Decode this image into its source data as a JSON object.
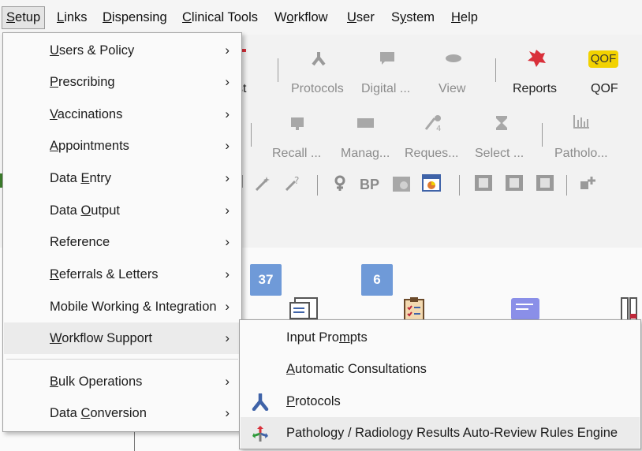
{
  "menubar": {
    "items": [
      {
        "pre": "",
        "acc": "S",
        "post": "etup"
      },
      {
        "pre": "",
        "acc": "L",
        "post": "inks"
      },
      {
        "pre": "",
        "acc": "D",
        "post": "ispensing"
      },
      {
        "pre": "",
        "acc": "C",
        "post": "linical Tools"
      },
      {
        "pre": "W",
        "acc": "o",
        "post": "rkflow"
      },
      {
        "pre": "",
        "acc": "U",
        "post": "ser"
      },
      {
        "pre": "S",
        "acc": "y",
        "post": "stem"
      },
      {
        "pre": "",
        "acc": "H",
        "post": "elp"
      }
    ]
  },
  "toolbar": {
    "row1": {
      "partial_label": "st",
      "protocols": "Protocols",
      "digital": "Digital ...",
      "view": "View",
      "reports": "Reports",
      "qof": "QOF",
      "qof_icon_text": "QOF"
    },
    "row2": {
      "recall": "Recall ...",
      "manage": "Manag...",
      "requests": "Reques...",
      "select": "Select ...",
      "pathology": "Patholo..."
    },
    "row3": {
      "bp_text": "BP"
    }
  },
  "badges": {
    "badge1": "37",
    "badge2": "6"
  },
  "setup_menu": {
    "items": [
      {
        "pre": "",
        "acc": "U",
        "post": "sers & Policy"
      },
      {
        "pre": "",
        "acc": "P",
        "post": "rescribing"
      },
      {
        "pre": "",
        "acc": "V",
        "post": "accinations"
      },
      {
        "pre": "",
        "acc": "A",
        "post": "ppointments"
      },
      {
        "pre": "Data ",
        "acc": "E",
        "post": "ntry"
      },
      {
        "pre": "Data ",
        "acc": "O",
        "post": "utput"
      },
      {
        "pre": "Reference",
        "acc": "",
        "post": ""
      },
      {
        "pre": "",
        "acc": "R",
        "post": "eferrals & Letters"
      },
      {
        "pre": "Mobile Working & Integration",
        "acc": "",
        "post": ""
      },
      {
        "pre": "",
        "acc": "W",
        "post": "orkflow Support"
      },
      {
        "pre": "",
        "acc": "B",
        "post": "ulk Operations"
      },
      {
        "pre": "Data ",
        "acc": "C",
        "post": "onversion"
      }
    ],
    "chevron": "›"
  },
  "workflow_submenu": {
    "items": [
      {
        "pre": "Input Pro",
        "acc": "m",
        "post": "pts"
      },
      {
        "pre": "",
        "acc": "A",
        "post": "utomatic Consultations"
      },
      {
        "pre": "",
        "acc": "P",
        "post": "rotocols"
      },
      {
        "pre": "Pathology / Radiology Results Auto-Review Rules Engine",
        "acc": "",
        "post": ""
      }
    ]
  },
  "colors": {
    "badge": "#6f9ad8",
    "reports_red": "#d9303a",
    "qof_yellow": "#f2d200",
    "icon_blue": "#3f63a8"
  }
}
